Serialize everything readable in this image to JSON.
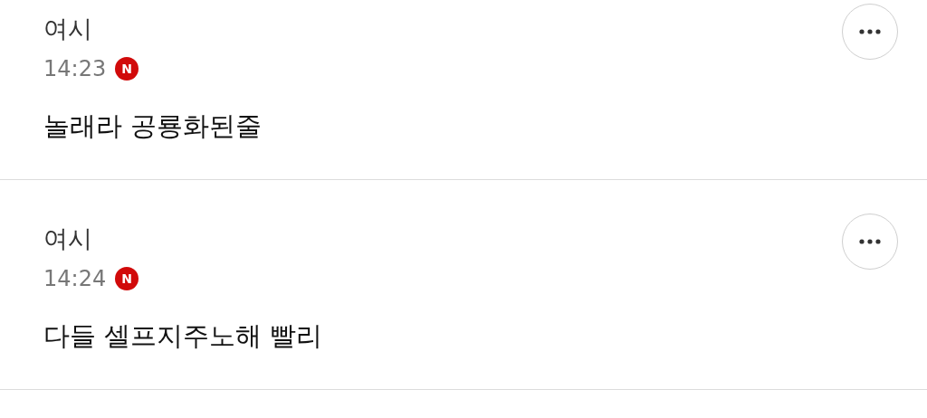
{
  "comments": [
    {
      "author": "여시",
      "time": "14:23",
      "badge": "N",
      "text": "놀래라 공룡화된줄"
    },
    {
      "author": "여시",
      "time": "14:24",
      "badge": "N",
      "text": "다들 셀프지주노해 빨리"
    }
  ]
}
